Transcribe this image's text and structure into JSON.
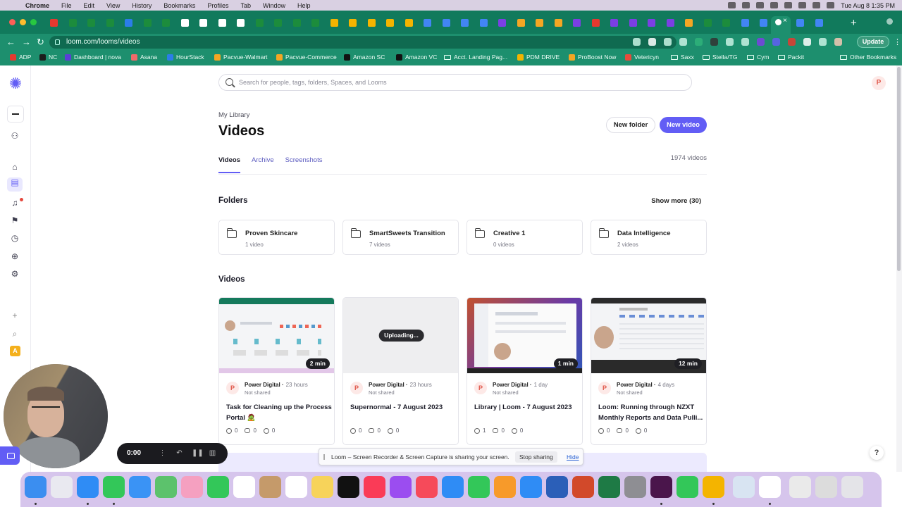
{
  "menubar": {
    "app": "Chrome",
    "items": [
      "File",
      "Edit",
      "View",
      "History",
      "Bookmarks",
      "Profiles",
      "Tab",
      "Window",
      "Help"
    ],
    "clock": "Tue Aug 8  1:35 PM"
  },
  "browser": {
    "url": "loom.com/looms/videos",
    "update_label": "Update"
  },
  "bookmarks": [
    {
      "label": "ADP",
      "icon": "adp-icon",
      "color": "#e5392f"
    },
    {
      "label": "NC",
      "icon": "nc-icon",
      "color": "#1c1c1c"
    },
    {
      "label": "Dashboard | nova",
      "icon": "nova-icon",
      "color": "#5b3fd6"
    },
    {
      "label": "Asana",
      "icon": "asana-icon",
      "color": "#f06a6a"
    },
    {
      "label": "HourStack",
      "icon": "hourstack-icon",
      "color": "#2b7de9"
    },
    {
      "label": "Pacvue-Walmart",
      "icon": "pacvue-icon",
      "color": "#f5a623"
    },
    {
      "label": "Pacvue-Commerce",
      "icon": "pacvue-icon",
      "color": "#f5a623"
    },
    {
      "label": "Amazon SC",
      "icon": "amazon-icon",
      "color": "#111111"
    },
    {
      "label": "Amazon VC",
      "icon": "amazon-icon",
      "color": "#111111"
    },
    {
      "label": "Acct. Landing Pag...",
      "icon": "folder-icon",
      "color": ""
    },
    {
      "label": "PDM DRIVE",
      "icon": "drive-icon",
      "color": "#f4b400"
    },
    {
      "label": "ProBoost Now",
      "icon": "proboost-icon",
      "color": "#f5a623"
    },
    {
      "label": "Vetericyn",
      "icon": "vetericyn-icon",
      "color": "#e64b3c"
    },
    {
      "label": "Saxx",
      "icon": "folder-icon",
      "color": ""
    },
    {
      "label": "Stella/TG",
      "icon": "folder-icon",
      "color": ""
    },
    {
      "label": "Cym",
      "icon": "folder-icon",
      "color": ""
    },
    {
      "label": "Packit",
      "icon": "folder-icon",
      "color": ""
    },
    {
      "label": "Other Bookmarks",
      "icon": "folder-icon",
      "color": ""
    }
  ],
  "search": {
    "placeholder": "Search for people, tags, folders, Spaces, and Looms"
  },
  "user_initial": "P",
  "page": {
    "breadcrumb": "My Library",
    "title": "Videos",
    "new_folder": "New folder",
    "new_video": "New video",
    "tabs": [
      "Videos",
      "Archive",
      "Screenshots"
    ],
    "count": "1974 videos"
  },
  "folders_section": {
    "title": "Folders",
    "show_more": "Show more (30)",
    "items": [
      {
        "name": "Proven Skincare",
        "count": "1 video"
      },
      {
        "name": "SmartSweets Transition",
        "count": "7 videos"
      },
      {
        "name": "Creative 1",
        "count": "0 videos"
      },
      {
        "name": "Data Intelligence",
        "count": "2 videos"
      }
    ]
  },
  "videos_section": {
    "title": "Videos",
    "items": [
      {
        "owner": "Power Digital",
        "age": "23 hours",
        "share": "Not shared",
        "title": "Task for Cleaning up the Process Portal 🧟",
        "duration": "2 min",
        "views": "0",
        "comments": "0",
        "reactions": "0"
      },
      {
        "owner": "Power Digital",
        "age": "23 hours",
        "share": "Not shared",
        "title": "Supernormal - 7 August 2023",
        "duration": "",
        "status": "Uploading...",
        "views": "0",
        "comments": "0",
        "reactions": "0"
      },
      {
        "owner": "Power Digital",
        "age": "1 day",
        "share": "Not shared",
        "title": "Library | Loom - 7 August 2023",
        "duration": "1 min",
        "views": "1",
        "comments": "0",
        "reactions": "0"
      },
      {
        "owner": "Power Digital",
        "age": "4 days",
        "share": "Not shared",
        "title": "Loom: Running through NZXT Monthly Reports and Data Pulli...",
        "duration": "12 min",
        "views": "0",
        "comments": "0",
        "reactions": "0"
      }
    ]
  },
  "share_banner": {
    "message": "Loom – Screen Recorder & Screen Capture is sharing your screen.",
    "stop": "Stop sharing",
    "hide": "Hide"
  },
  "recorder": {
    "time": "0:00"
  },
  "help": "?",
  "colors": {
    "accent": "#625df5",
    "chrome_green": "#1d8f6e"
  }
}
